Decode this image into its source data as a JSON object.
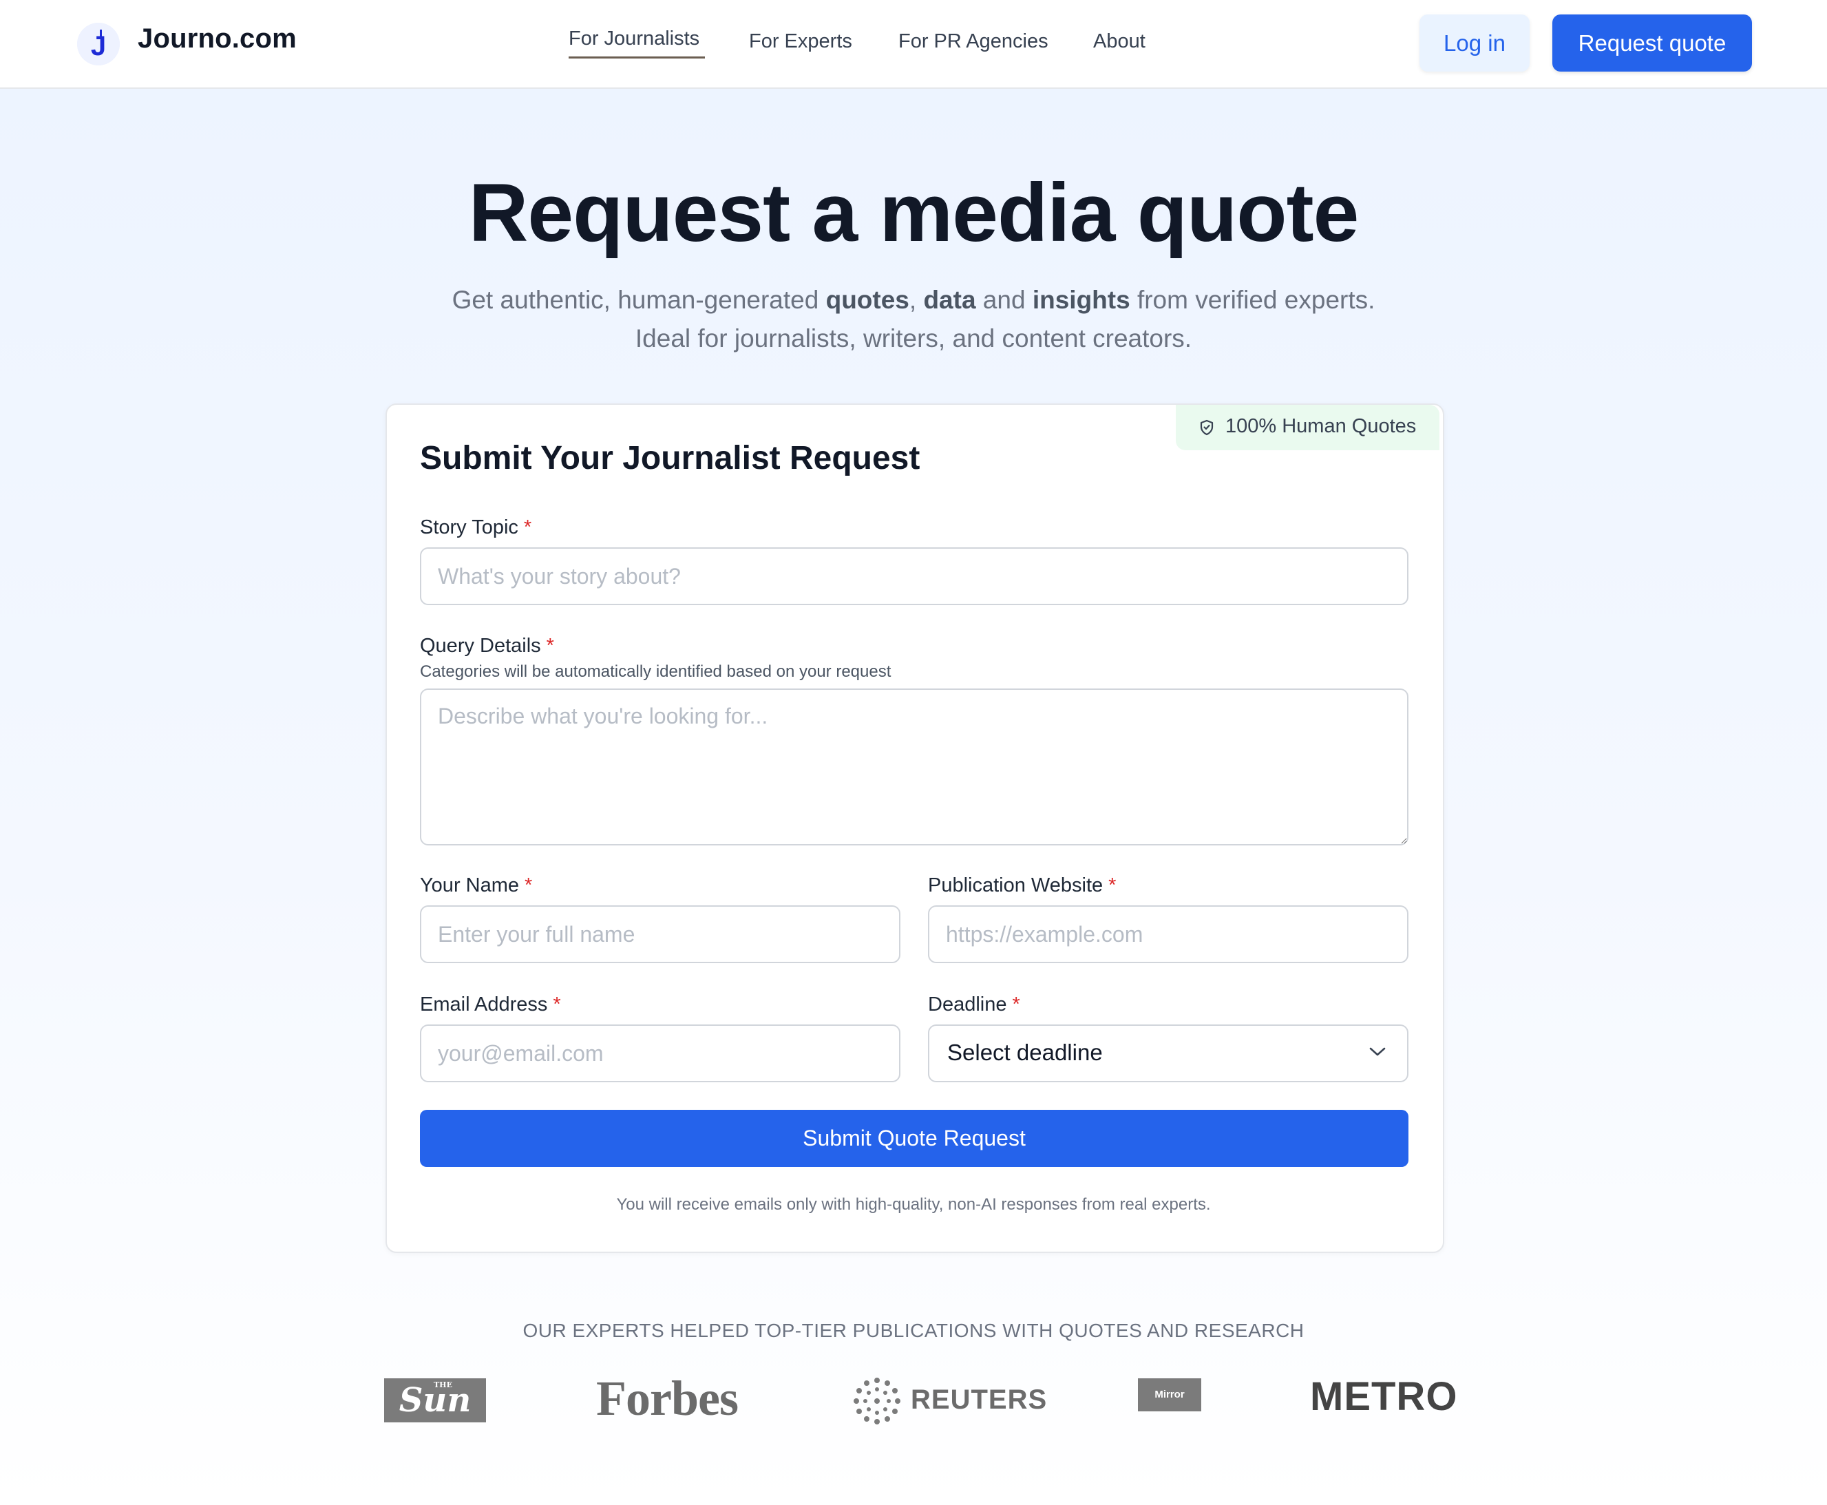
{
  "header": {
    "brand": "Journo.com",
    "logo_letter": "J",
    "nav": [
      {
        "label": "For Journalists",
        "active": true
      },
      {
        "label": "For Experts"
      },
      {
        "label": "For PR Agencies"
      },
      {
        "label": "About"
      }
    ],
    "login_label": "Log in",
    "request_quote_label": "Request quote"
  },
  "hero": {
    "title": "Request a media quote",
    "subtitle_parts": [
      "Get authentic, human-generated ",
      "quotes",
      ", ",
      "data",
      " and ",
      "insights",
      " from verified experts. Ideal for journalists, writers, and content creators."
    ]
  },
  "form": {
    "badge": "100% Human Quotes",
    "title": "Submit Your Journalist Request",
    "required_marker": "*",
    "story_topic": {
      "label": "Story Topic",
      "placeholder": "What's your story about?",
      "value": ""
    },
    "query_details": {
      "label": "Query Details",
      "hint": "Categories will be automatically identified based on your request",
      "placeholder": "Describe what you're looking for...",
      "value": ""
    },
    "your_name": {
      "label": "Your Name",
      "placeholder": "Enter your full name",
      "value": ""
    },
    "publication_website": {
      "label": "Publication Website",
      "placeholder": "https://example.com",
      "value": ""
    },
    "email": {
      "label": "Email Address",
      "placeholder": "your@email.com",
      "value": ""
    },
    "deadline": {
      "label": "Deadline",
      "selected": "Select deadline"
    },
    "submit_label": "Submit Quote Request",
    "note": "You will receive emails only with high-quality, non-AI responses from real experts."
  },
  "publications": {
    "heading": "OUR EXPERTS HELPED TOP-TIER PUBLICATIONS WITH QUOTES AND RESEARCH",
    "logos": [
      "The Sun",
      "Forbes",
      "REUTERS",
      "Mirror",
      "METRO"
    ],
    "sun_text": "Sun",
    "sun_small": "THE"
  },
  "colors": {
    "accent": "#2563eb",
    "required": "#dc2626",
    "badge_bg": "#eafaef",
    "login_bg": "#eaf3ff"
  },
  "icons": {
    "badge_icon": "shield-check-icon",
    "deadline_icon": "chevron-down-icon",
    "brand_icon": "journo-logo-icon"
  }
}
